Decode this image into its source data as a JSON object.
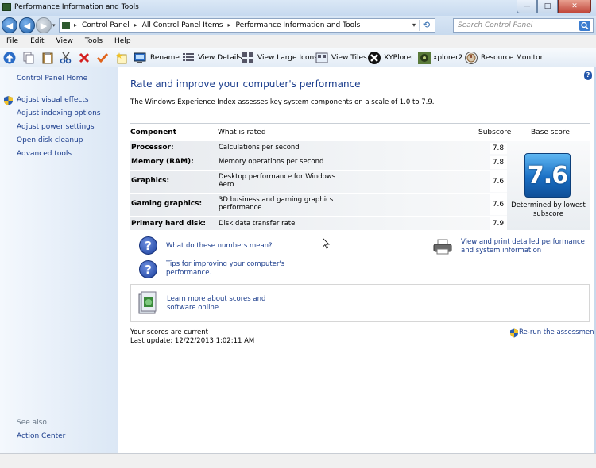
{
  "window": {
    "title": "Performance Information and Tools",
    "controls": {
      "minimize": "—",
      "maximize": "□",
      "close": "✕"
    }
  },
  "nav": {
    "breadcrumb": [
      "Control Panel",
      "All Control Panel Items",
      "Performance Information and Tools"
    ],
    "search_placeholder": "Search Control Panel"
  },
  "menu": [
    "File",
    "Edit",
    "View",
    "Tools",
    "Help"
  ],
  "toolbar": {
    "rename": "Rename",
    "view_details": "View Details",
    "view_large_icons": "View Large Icons",
    "view_tiles": "View Tiles",
    "xyplorer": "XYPlorer",
    "xplorer2": "xplorer2",
    "resource_monitor": "Resource Monitor"
  },
  "sidebar": {
    "home": "Control Panel Home",
    "links": [
      "Adjust visual effects",
      "Adjust indexing options",
      "Adjust power settings",
      "Open disk cleanup",
      "Advanced tools"
    ],
    "see_also": "See also",
    "action_center": "Action Center"
  },
  "main": {
    "title": "Rate and improve your computer's performance",
    "intro": "The Windows Experience Index assesses key system components on a scale of 1.0 to 7.9.",
    "table": {
      "headers": {
        "component": "Component",
        "what": "What is rated",
        "subscore": "Subscore",
        "base": "Base score"
      },
      "rows": [
        {
          "component": "Processor:",
          "what": "Calculations per second",
          "score": "7.8"
        },
        {
          "component": "Memory (RAM):",
          "what": "Memory operations per second",
          "score": "7.8"
        },
        {
          "component": "Graphics:",
          "what": "Desktop performance for Windows Aero",
          "score": "7.6"
        },
        {
          "component": "Gaming graphics:",
          "what": "3D business and gaming graphics performance",
          "score": "7.6"
        },
        {
          "component": "Primary hard disk:",
          "what": "Disk data transfer rate",
          "score": "7.9"
        }
      ],
      "base_score": "7.6",
      "base_caption": "Determined by lowest subscore"
    },
    "links": {
      "numbers": "What do these numbers mean?",
      "tips": "Tips for improving your computer's performance.",
      "print": "View and print detailed performance and system information",
      "learn": "Learn more about scores and software online"
    },
    "status": {
      "current": "Your scores are current",
      "last_update": "Last update: 12/22/2013 1:02:11 AM"
    },
    "rerun": "Re-run the assessment"
  },
  "colors": {
    "link": "#1a3c8c",
    "score_tile": "#1a6fc4"
  }
}
